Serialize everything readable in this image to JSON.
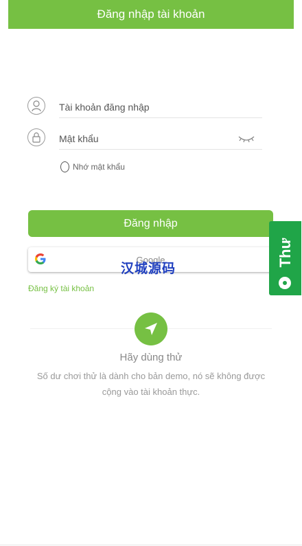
{
  "header": {
    "title": "Đăng nhập tài khoản"
  },
  "form": {
    "username_placeholder": "Tài khoản đăng nhập",
    "username_value": "",
    "password_placeholder": "Mật khẩu",
    "password_value": "",
    "remember_label": "Nhớ mật khẩu",
    "login_label": "Đăng nhập",
    "google_label": "Google",
    "register_label": "Đăng ký tài khoản"
  },
  "watermark": {
    "text": "汉城源码"
  },
  "trial": {
    "title": "Hãy dùng thử",
    "description": "Số dư chơi thử là dành cho bản demo, nó sẽ không được cộng vào tài khoản thực."
  },
  "side_tab": {
    "label": "Thư"
  },
  "icons": {
    "user": "user-icon",
    "lock": "lock-icon",
    "eye": "eye-closed-icon",
    "google": "google-logo-icon",
    "trial": "send-arrow-icon",
    "chat": "chat-bubble-icon"
  },
  "colors": {
    "primary": "#76c043",
    "side_tab": "#20a548",
    "watermark": "#1f3fbf"
  }
}
